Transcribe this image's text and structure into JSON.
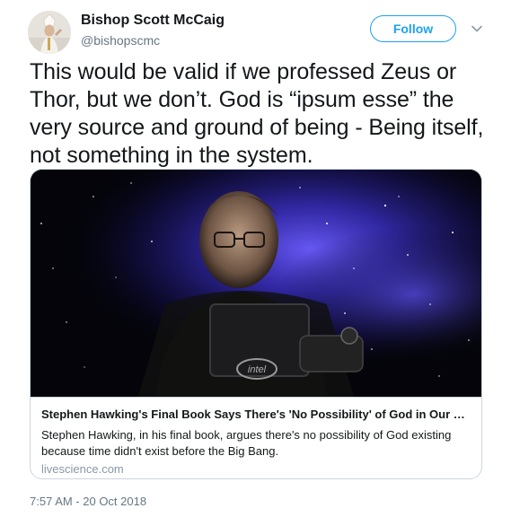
{
  "author": {
    "name": "Bishop Scott McCaig",
    "handle": "@bishopscmc"
  },
  "follow_label": "Follow",
  "tweet_text": "This would be valid if we professed Zeus or Thor, but we don’t. God is “ipsum esse” the very source and ground of being - Being itself, not something in the system.",
  "card": {
    "title": "Stephen Hawking's Final Book Says There's 'No Possibility' of God in Our Uni...",
    "description": "Stephen Hawking, in his final book, argues there's no possibility of God existing because time didn't exist before the Big Bang.",
    "domain": "livescience.com",
    "image_logo_text": "intel"
  },
  "timestamp": "7:57 AM - 20 Oct 2018",
  "colors": {
    "accent": "#1da1f2",
    "secondary_text": "#657786",
    "border": "#ccd6dd"
  },
  "icons": {
    "menu": "chevron-down-icon"
  }
}
